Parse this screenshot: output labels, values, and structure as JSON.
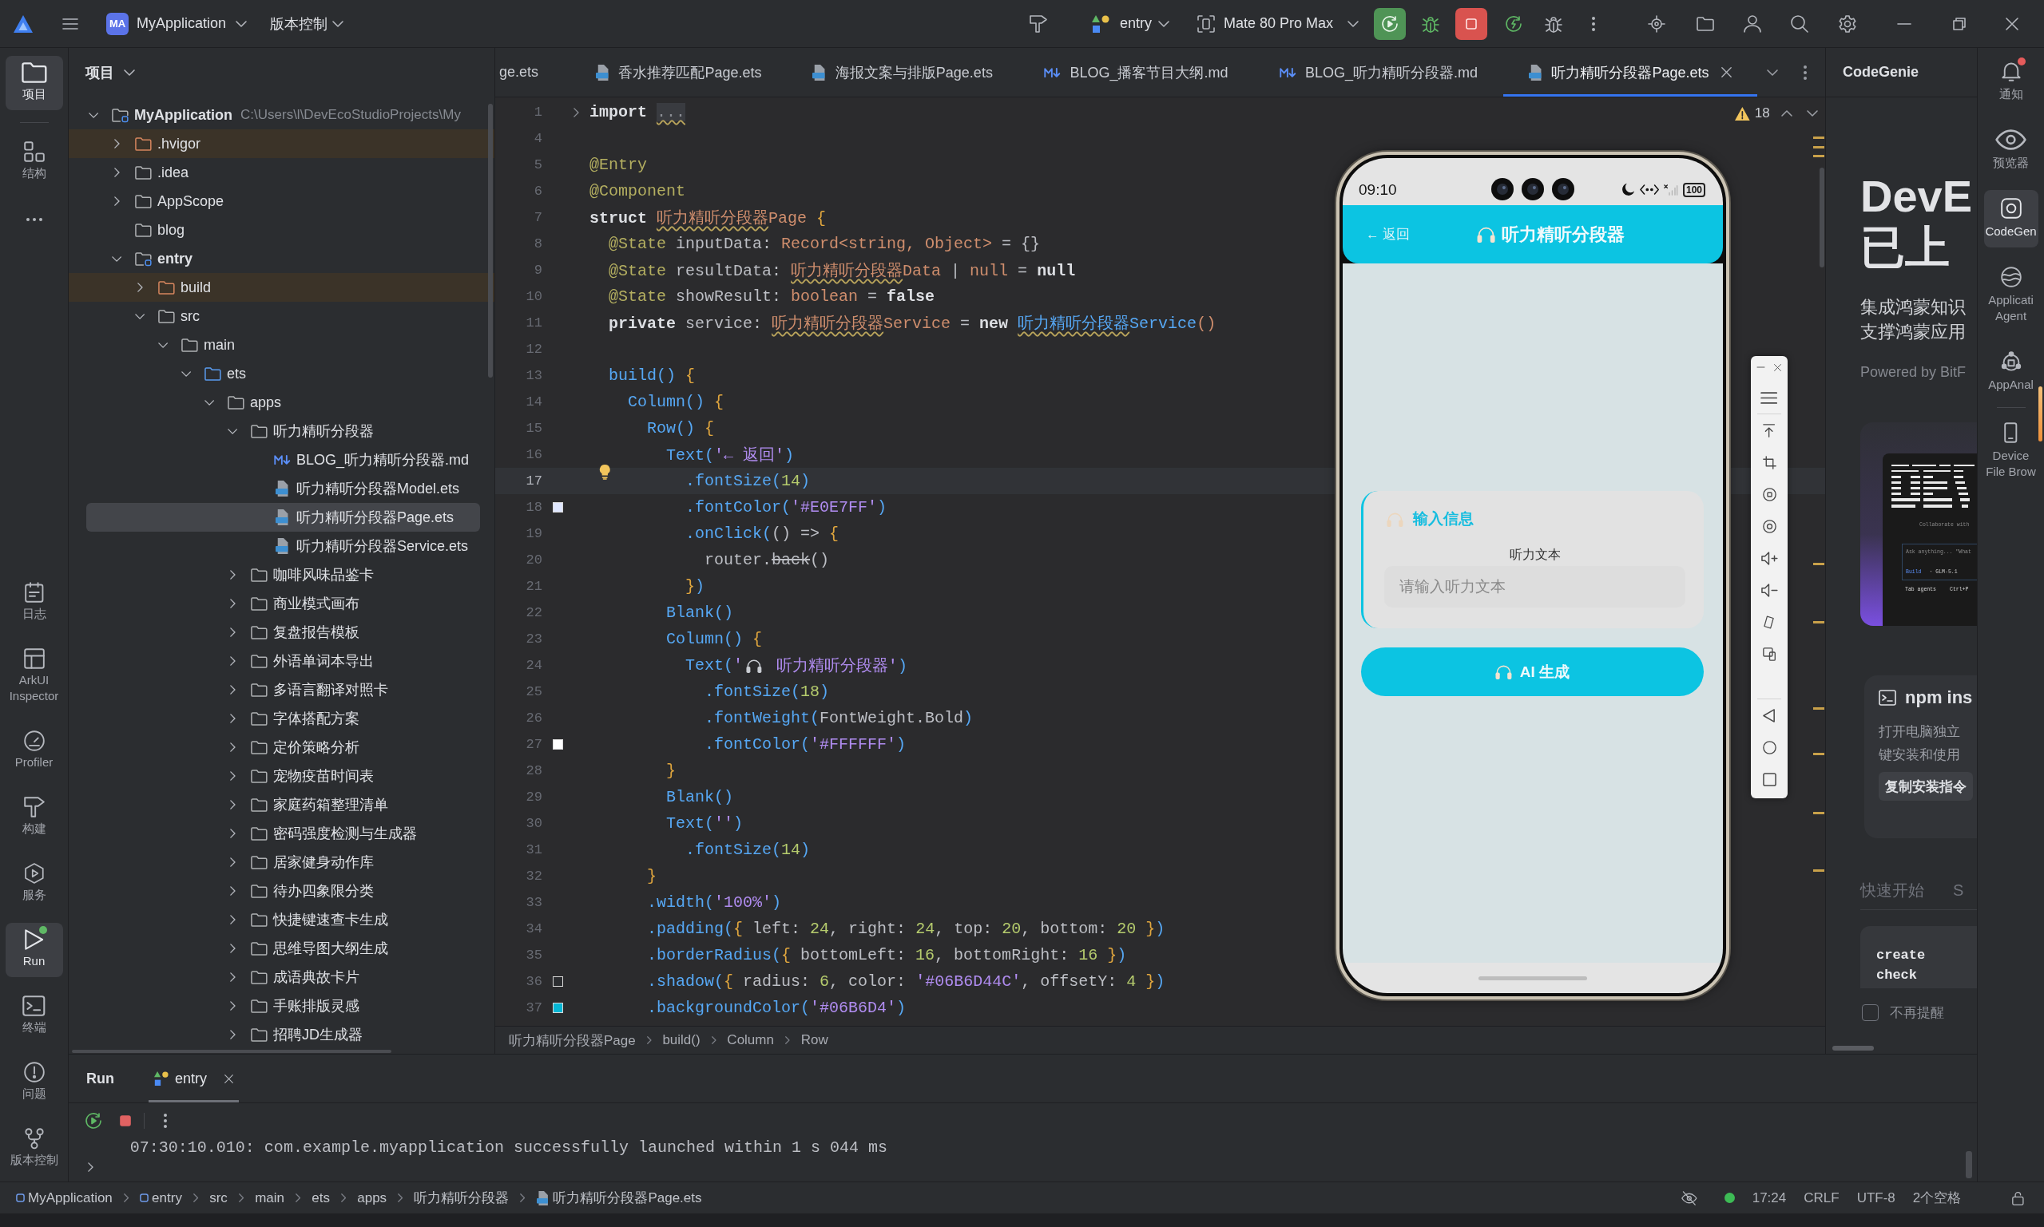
{
  "title_bar": {
    "project_badge": "MA",
    "project": "MyApplication",
    "vcs": "版本控制",
    "run_config": "entry",
    "device": "Mate 80 Pro Max"
  },
  "tool_strip": {
    "top": [
      {
        "kind": "project",
        "label": "项目",
        "selected": true,
        "running": false
      },
      {
        "kind": "structure",
        "label": "结构",
        "selected": false,
        "running": false
      }
    ],
    "bottom": [
      {
        "kind": "log",
        "label": "日志",
        "selected": false,
        "running": false
      },
      {
        "kind": "inspector",
        "label": "ArkUI Inspector",
        "selected": false,
        "running": false
      },
      {
        "kind": "profiler",
        "label": "Profiler",
        "selected": false,
        "running": false
      },
      {
        "kind": "build",
        "label": "构建",
        "selected": false,
        "running": false
      },
      {
        "kind": "services",
        "label": "服务",
        "selected": false,
        "running": false
      },
      {
        "kind": "run",
        "label": "Run",
        "selected": true,
        "running": true
      },
      {
        "kind": "terminal",
        "label": "终端",
        "selected": false,
        "running": false
      },
      {
        "kind": "problems",
        "label": "问题",
        "selected": false,
        "running": false
      },
      {
        "kind": "vcs",
        "label": "版本控制",
        "selected": false,
        "running": false
      }
    ]
  },
  "project_panel": {
    "title": "项目",
    "tree": [
      {
        "name": "MyApplication",
        "kind": "module",
        "path": "C:\\Users\\l\\DevEcoStudioProjects\\My",
        "expanded": true,
        "selected": false,
        "children": [
          {
            "name": ".hvigor",
            "kind": "excluded",
            "expanded": false,
            "selected": false
          },
          {
            "name": ".idea",
            "kind": "folder",
            "expanded": false,
            "selected": false
          },
          {
            "name": "AppScope",
            "kind": "folder",
            "expanded": false,
            "selected": false
          },
          {
            "name": "blog",
            "kind": "folder",
            "selected": false
          },
          {
            "name": "entry",
            "kind": "module",
            "expanded": true,
            "selected": false,
            "children": [
              {
                "name": "build",
                "kind": "excluded",
                "expanded": false,
                "selected": false
              },
              {
                "name": "src",
                "kind": "folder",
                "expanded": true,
                "selected": false,
                "children": [
                  {
                    "name": "main",
                    "kind": "folder",
                    "expanded": true,
                    "selected": false,
                    "children": [
                      {
                        "name": "ets",
                        "kind": "source",
                        "expanded": true,
                        "selected": false,
                        "children": [
                          {
                            "name": "apps",
                            "kind": "folder",
                            "expanded": true,
                            "selected": false,
                            "children": [
                              {
                                "name": "听力精听分段器",
                                "kind": "folder",
                                "expanded": true,
                                "selected": false,
                                "children": [
                                  {
                                    "name": "BLOG_听力精听分段器.md",
                                    "kind": "md",
                                    "selected": false
                                  },
                                  {
                                    "name": "听力精听分段器Model.ets",
                                    "kind": "ets",
                                    "selected": false
                                  },
                                  {
                                    "name": "听力精听分段器Page.ets",
                                    "kind": "ets",
                                    "selected": true
                                  },
                                  {
                                    "name": "听力精听分段器Service.ets",
                                    "kind": "ets",
                                    "selected": false
                                  }
                                ]
                              },
                              {
                                "name": "咖啡风味品鉴卡",
                                "kind": "folder",
                                "expanded": false,
                                "selected": false
                              },
                              {
                                "name": "商业模式画布",
                                "kind": "folder",
                                "expanded": false,
                                "selected": false
                              },
                              {
                                "name": "复盘报告模板",
                                "kind": "folder",
                                "expanded": false,
                                "selected": false
                              },
                              {
                                "name": "外语单词本导出",
                                "kind": "folder",
                                "expanded": false,
                                "selected": false
                              },
                              {
                                "name": "多语言翻译对照卡",
                                "kind": "folder",
                                "expanded": false,
                                "selected": false
                              },
                              {
                                "name": "字体搭配方案",
                                "kind": "folder",
                                "expanded": false,
                                "selected": false
                              },
                              {
                                "name": "定价策略分析",
                                "kind": "folder",
                                "expanded": false,
                                "selected": false
                              },
                              {
                                "name": "宠物疫苗时间表",
                                "kind": "folder",
                                "expanded": false,
                                "selected": false
                              },
                              {
                                "name": "家庭药箱整理清单",
                                "kind": "folder",
                                "expanded": false,
                                "selected": false
                              },
                              {
                                "name": "密码强度检测与生成器",
                                "kind": "folder",
                                "expanded": false,
                                "selected": false
                              },
                              {
                                "name": "居家健身动作库",
                                "kind": "folder",
                                "expanded": false,
                                "selected": false
                              },
                              {
                                "name": "待办四象限分类",
                                "kind": "folder",
                                "expanded": false,
                                "selected": false
                              },
                              {
                                "name": "快捷键速查卡生成",
                                "kind": "folder",
                                "expanded": false,
                                "selected": false
                              },
                              {
                                "name": "思维导图大纲生成",
                                "kind": "folder",
                                "expanded": false,
                                "selected": false
                              },
                              {
                                "name": "成语典故卡片",
                                "kind": "folder",
                                "expanded": false,
                                "selected": false
                              },
                              {
                                "name": "手账排版灵感",
                                "kind": "folder",
                                "expanded": false,
                                "selected": false
                              },
                              {
                                "name": "招聘JD生成器",
                                "kind": "folder",
                                "expanded": false,
                                "selected": false
                              }
                            ]
                          }
                        ]
                      }
                    ]
                  }
                ]
              }
            ]
          }
        ]
      }
    ]
  },
  "editor": {
    "tabs": [
      {
        "label": "ge.ets",
        "kind": "clipped",
        "selected": false
      },
      {
        "label": "香水推荐匹配Page.ets",
        "kind": "ets",
        "selected": false
      },
      {
        "label": "海报文案与排版Page.ets",
        "kind": "ets",
        "selected": false
      },
      {
        "label": "BLOG_播客节目大纲.md",
        "kind": "md",
        "selected": false
      },
      {
        "label": "BLOG_听力精听分段器.md",
        "kind": "md",
        "selected": false
      },
      {
        "label": "听力精听分段器Page.ets",
        "kind": "ets",
        "selected": true
      }
    ],
    "warnings": "18",
    "lines": [
      {
        "number": "1",
        "current": false,
        "gutter": {
          "kind": "fold"
        },
        "tokens": [
          {
            "text": "import ",
            "kind": "kw"
          },
          {
            "text": "...",
            "kind": "fold"
          }
        ]
      },
      {
        "number": "4",
        "current": false
      },
      {
        "number": "5",
        "current": false,
        "tokens": [
          {
            "text": "@Entry",
            "kind": "ann"
          }
        ]
      },
      {
        "number": "6",
        "current": false,
        "tokens": [
          {
            "text": "@Component",
            "kind": "ann"
          }
        ]
      },
      {
        "number": "7",
        "current": false,
        "tokens": [
          {
            "text": "struct ",
            "kind": "kw"
          },
          {
            "text": "听力精听分段器",
            "kind": "warn"
          },
          {
            "text": "Page",
            "kind": "type"
          },
          {
            "text": " {",
            "kind": "brace"
          }
        ]
      },
      {
        "number": "8",
        "current": false,
        "tokens": [
          {
            "text": "  @State",
            "kind": "ann"
          },
          {
            "text": " inputData: ",
            "kind": "plain"
          },
          {
            "text": "Record<string, Object>",
            "kind": "type"
          },
          {
            "text": " = {}",
            "kind": "plain"
          }
        ]
      },
      {
        "number": "9",
        "current": false,
        "tokens": [
          {
            "text": "  @State",
            "kind": "ann"
          },
          {
            "text": " resultData: ",
            "kind": "plain"
          },
          {
            "text": "听力精听分段器",
            "kind": "warn"
          },
          {
            "text": "Data",
            "kind": "type"
          },
          {
            "text": " | ",
            "kind": "plain"
          },
          {
            "text": "null",
            "kind": "type"
          },
          {
            "text": " = ",
            "kind": "plain"
          },
          {
            "text": "null",
            "kind": "kw"
          }
        ]
      },
      {
        "number": "10",
        "current": false,
        "tokens": [
          {
            "text": "  @State",
            "kind": "ann"
          },
          {
            "text": " showResult: ",
            "kind": "plain"
          },
          {
            "text": "boolean",
            "kind": "type"
          },
          {
            "text": " = ",
            "kind": "plain"
          },
          {
            "text": "false",
            "kind": "kw"
          }
        ]
      },
      {
        "number": "11",
        "current": false,
        "tokens": [
          {
            "text": "  private",
            "kind": "kw"
          },
          {
            "text": " service: ",
            "kind": "plain"
          },
          {
            "text": "听力精听分段器",
            "kind": "warn"
          },
          {
            "text": "Service",
            "kind": "type"
          },
          {
            "text": " = ",
            "kind": "plain"
          },
          {
            "text": "new ",
            "kind": "kw"
          },
          {
            "text": "听力精听分段器",
            "kind": "warnfn"
          },
          {
            "text": "Service",
            "kind": "fn"
          },
          {
            "text": "()",
            "kind": "type"
          }
        ]
      },
      {
        "number": "12",
        "current": false
      },
      {
        "number": "13",
        "current": false,
        "tokens": [
          {
            "text": "  build()",
            "kind": "fn"
          },
          {
            "text": " {",
            "kind": "brace"
          }
        ]
      },
      {
        "number": "14",
        "current": false,
        "tokens": [
          {
            "text": "    Column()",
            "kind": "fn"
          },
          {
            "text": " {",
            "kind": "brace"
          }
        ]
      },
      {
        "number": "15",
        "current": false,
        "tokens": [
          {
            "text": "      Row()",
            "kind": "fn"
          },
          {
            "text": " {",
            "kind": "brace"
          }
        ]
      },
      {
        "number": "16",
        "current": false,
        "tokens": [
          {
            "text": "        Text(",
            "kind": "fn"
          },
          {
            "text": "'← 返回'",
            "kind": "str"
          },
          {
            "text": ")",
            "kind": "fn"
          }
        ]
      },
      {
        "number": "17",
        "current": true,
        "gutter": {
          "kind": "bulb"
        },
        "tokens": [
          {
            "text": "          .fontSize(",
            "kind": "fn"
          },
          {
            "text": "14",
            "kind": "num"
          },
          {
            "text": ")",
            "kind": "fn"
          }
        ]
      },
      {
        "number": "18",
        "current": false,
        "gutter": {
          "kind": "swatch",
          "color": "#e0e7ff"
        },
        "tokens": [
          {
            "text": "          .fontColor(",
            "kind": "fn"
          },
          {
            "text": "'#E0E7FF'",
            "kind": "str"
          },
          {
            "text": ")",
            "kind": "fn"
          }
        ]
      },
      {
        "number": "19",
        "current": false,
        "tokens": [
          {
            "text": "          .onClick(",
            "kind": "fn"
          },
          {
            "text": "() => ",
            "kind": "plain"
          },
          {
            "text": "{",
            "kind": "brace"
          }
        ]
      },
      {
        "number": "20",
        "current": false,
        "tokens": [
          {
            "text": "            router.",
            "kind": "plain"
          },
          {
            "text": "back",
            "kind": "dep"
          },
          {
            "text": "()",
            "kind": "plain"
          }
        ]
      },
      {
        "number": "21",
        "current": false,
        "tokens": [
          {
            "text": "          }",
            "kind": "brace"
          },
          {
            "text": ")",
            "kind": "fn"
          }
        ]
      },
      {
        "number": "22",
        "current": false,
        "tokens": [
          {
            "text": "        Blank()",
            "kind": "fn"
          }
        ]
      },
      {
        "number": "23",
        "current": false,
        "tokens": [
          {
            "text": "        Column()",
            "kind": "fn"
          },
          {
            "text": " {",
            "kind": "brace"
          }
        ]
      },
      {
        "number": "24",
        "current": false,
        "tokens": [
          {
            "text": "          Text(",
            "kind": "fn"
          },
          {
            "text": "'",
            "kind": "str"
          },
          {
            "kind": "headphones"
          },
          {
            "text": " 听力精听分段器'",
            "kind": "str"
          },
          {
            "text": ")",
            "kind": "fn"
          }
        ]
      },
      {
        "number": "25",
        "current": false,
        "tokens": [
          {
            "text": "            .fontSize(",
            "kind": "fn"
          },
          {
            "text": "18",
            "kind": "num"
          },
          {
            "text": ")",
            "kind": "fn"
          }
        ]
      },
      {
        "number": "26",
        "current": false,
        "tokens": [
          {
            "text": "            .fontWeight(",
            "kind": "fn"
          },
          {
            "text": "FontWeight.Bold",
            "kind": "plain"
          },
          {
            "text": ")",
            "kind": "fn"
          }
        ]
      },
      {
        "number": "27",
        "current": false,
        "gutter": {
          "kind": "swatch",
          "color": "#ffffff"
        },
        "tokens": [
          {
            "text": "            .fontColor(",
            "kind": "fn"
          },
          {
            "text": "'#FFFFFF'",
            "kind": "str"
          },
          {
            "text": ")",
            "kind": "fn"
          }
        ]
      },
      {
        "number": "28",
        "current": false,
        "tokens": [
          {
            "text": "        }",
            "kind": "brace"
          }
        ]
      },
      {
        "number": "29",
        "current": false,
        "tokens": [
          {
            "text": "        Blank()",
            "kind": "fn"
          }
        ]
      },
      {
        "number": "30",
        "current": false,
        "tokens": [
          {
            "text": "        Text(",
            "kind": "fn"
          },
          {
            "text": "''",
            "kind": "str"
          },
          {
            "text": ")",
            "kind": "fn"
          }
        ]
      },
      {
        "number": "31",
        "current": false,
        "tokens": [
          {
            "text": "          .fontSize(",
            "kind": "fn"
          },
          {
            "text": "14",
            "kind": "num"
          },
          {
            "text": ")",
            "kind": "fn"
          }
        ]
      },
      {
        "number": "32",
        "current": false,
        "tokens": [
          {
            "text": "      }",
            "kind": "brace"
          }
        ]
      },
      {
        "number": "33",
        "current": false,
        "tokens": [
          {
            "text": "      .width(",
            "kind": "fn"
          },
          {
            "text": "'100%'",
            "kind": "str"
          },
          {
            "text": ")",
            "kind": "fn"
          }
        ]
      },
      {
        "number": "34",
        "current": false,
        "tokens": [
          {
            "text": "      .padding(",
            "kind": "fn"
          },
          {
            "text": "{",
            "kind": "brace"
          },
          {
            "text": " left: ",
            "kind": "plain"
          },
          {
            "text": "24",
            "kind": "num"
          },
          {
            "text": ", right: ",
            "kind": "plain"
          },
          {
            "text": "24",
            "kind": "num"
          },
          {
            "text": ", top: ",
            "kind": "plain"
          },
          {
            "text": "20",
            "kind": "num"
          },
          {
            "text": ", bottom: ",
            "kind": "plain"
          },
          {
            "text": "20",
            "kind": "num"
          },
          {
            "text": " }",
            "kind": "brace"
          },
          {
            "text": ")",
            "kind": "fn"
          }
        ]
      },
      {
        "number": "35",
        "current": false,
        "tokens": [
          {
            "text": "      .borderRadius(",
            "kind": "fn"
          },
          {
            "text": "{",
            "kind": "brace"
          },
          {
            "text": " bottomLeft: ",
            "kind": "plain"
          },
          {
            "text": "16",
            "kind": "num"
          },
          {
            "text": ", bottomRight: ",
            "kind": "plain"
          },
          {
            "text": "16",
            "kind": "num"
          },
          {
            "text": " }",
            "kind": "brace"
          },
          {
            "text": ")",
            "kind": "fn"
          }
        ]
      },
      {
        "number": "36",
        "current": false,
        "gutter": {
          "kind": "swatch",
          "color": "#2b2d30"
        },
        "tokens": [
          {
            "text": "      .shadow(",
            "kind": "fn"
          },
          {
            "text": "{",
            "kind": "brace"
          },
          {
            "text": " radius: ",
            "kind": "plain"
          },
          {
            "text": "6",
            "kind": "num"
          },
          {
            "text": ", color: ",
            "kind": "plain"
          },
          {
            "text": "'#06B6D44C'",
            "kind": "str"
          },
          {
            "text": ", offsetY: ",
            "kind": "plain"
          },
          {
            "text": "4",
            "kind": "num"
          },
          {
            "text": " }",
            "kind": "brace"
          },
          {
            "text": ")",
            "kind": "fn"
          }
        ]
      },
      {
        "number": "37",
        "current": false,
        "gutter": {
          "kind": "swatch",
          "color": "#06b6d4"
        },
        "tokens": [
          {
            "text": "      .backgroundColor(",
            "kind": "fn"
          },
          {
            "text": "'#06B6D4'",
            "kind": "str"
          },
          {
            "text": ")",
            "kind": "fn"
          }
        ]
      }
    ],
    "breadcrumb": [
      "听力精听分段器Page",
      "build()",
      "Column",
      "Row"
    ]
  },
  "preview": {
    "time": "09:10",
    "battery": "100",
    "back": "← 返回",
    "title": "听力精听分段器",
    "card_title": "输入信息",
    "field_label": "听力文本",
    "placeholder": "请输入听力文本",
    "button": "AI 生成"
  },
  "codegenie": {
    "title": "CodeGenie",
    "headline": [
      "DevE",
      "已上"
    ],
    "description": [
      "集成鸿蒙知识",
      "支撑鸿蒙应用"
    ],
    "powered_by": "Powered by BitF",
    "preview_card": {
      "tagline": "Collaborate with",
      "prompt": "Ask anything... \"What",
      "mode": "Build",
      "model": "· GLM-5.1",
      "footer": [
        "Tab agents",
        "Ctrl+P"
      ]
    },
    "install_card": {
      "title": "npm ins",
      "description": [
        "打开电脑独立",
        "键安装和使用"
      ],
      "button": "复制安装指令"
    },
    "tabs": [
      {
        "label": "快速开始",
        "selected": false
      },
      {
        "label": "S",
        "selected": false
      }
    ],
    "commands": [
      "create",
      "check"
    ],
    "dont_remind": {
      "label": "不再提醒",
      "checked": false
    }
  },
  "right_strip": [
    {
      "kind": "bell",
      "label": "通知",
      "selected": false,
      "unread": true
    },
    {
      "kind": "eye",
      "label": "预览器",
      "selected": false,
      "unread": false
    },
    {
      "kind": "genie",
      "label": "CodeGen",
      "selected": true,
      "unread": false
    },
    {
      "kind": "agent",
      "label": "Applicati Agent",
      "selected": false,
      "unread": false
    },
    {
      "kind": "analytics",
      "label": "AppAnal",
      "selected": false,
      "unread": false
    },
    {
      "kind": "device",
      "label": "Device File Brow",
      "selected": false,
      "unread": false
    }
  ],
  "run_panel": {
    "title": "Run",
    "tabs": [
      {
        "label": "entry",
        "selected": true
      }
    ],
    "output": "07:30:10.010: com.example.myapplication successfully launched within 1 s 044 ms"
  },
  "status_bar": {
    "path": [
      {
        "label": "MyApplication",
        "kind": "module"
      },
      {
        "label": "entry",
        "kind": "module"
      },
      {
        "label": "src",
        "kind": "dir"
      },
      {
        "label": "main",
        "kind": "dir"
      },
      {
        "label": "ets",
        "kind": "dir"
      },
      {
        "label": "apps",
        "kind": "dir"
      },
      {
        "label": "听力精听分段器",
        "kind": "dir"
      },
      {
        "label": "听力精听分段器Page.ets",
        "kind": "ets"
      }
    ],
    "cursor": "17:24",
    "line_separator": "CRLF",
    "encoding": "UTF-8",
    "indent": "2个空格"
  }
}
